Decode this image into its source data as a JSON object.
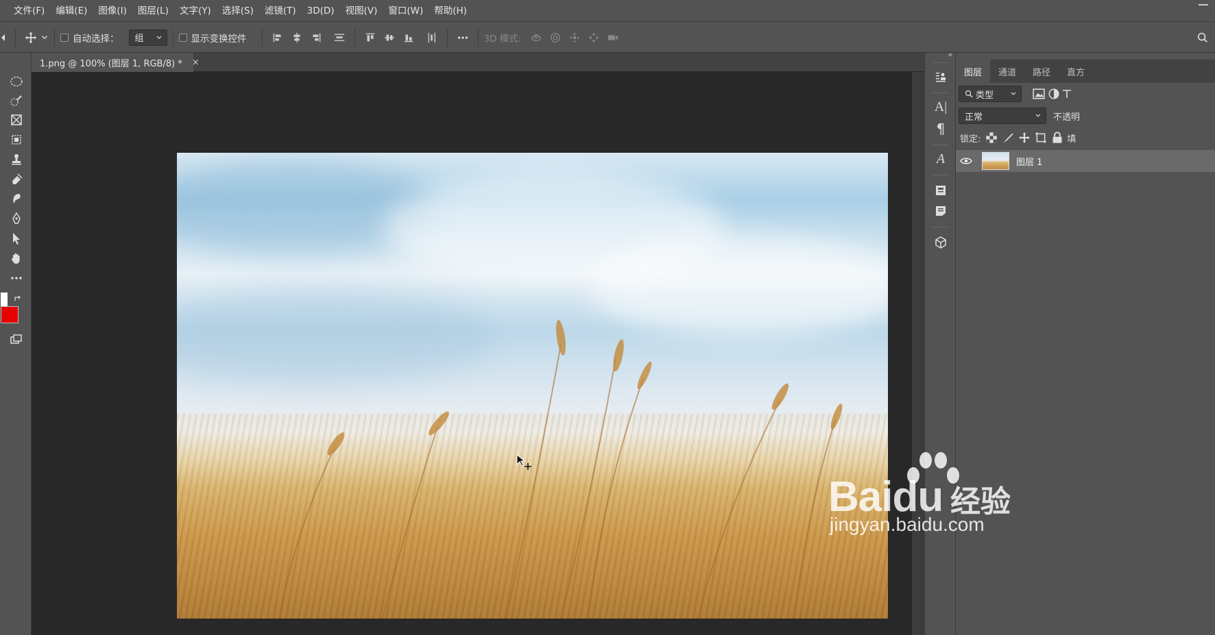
{
  "menu": {
    "items": [
      "文件(F)",
      "编辑(E)",
      "图像(I)",
      "图层(L)",
      "文字(Y)",
      "选择(S)",
      "滤镜(T)",
      "3D(D)",
      "视图(V)",
      "窗口(W)",
      "帮助(H)"
    ]
  },
  "options": {
    "auto_select_label": "自动选择：",
    "auto_select_value": "组",
    "show_transform_label": "显示变换控件",
    "mode_3d_label": "3D 模式:"
  },
  "document": {
    "tab_title": "1.png @ 100% (图层 1, RGB/8) *",
    "close": "×"
  },
  "colors": {
    "foreground": "#ffffff",
    "background": "#e60000"
  },
  "layers_panel": {
    "tabs": [
      "图层",
      "通道",
      "路径",
      "直方"
    ],
    "filter_value": "类型",
    "blend_mode": "正常",
    "opacity_label": "不透明",
    "lock_label": "锁定:",
    "fill_label": "填",
    "layers": [
      {
        "name": "图层 1",
        "visible": true
      }
    ]
  },
  "watermark": {
    "brand": "Bai",
    "brand2": "du",
    "cn": "经验",
    "url": "jingyan.baidu.com"
  }
}
